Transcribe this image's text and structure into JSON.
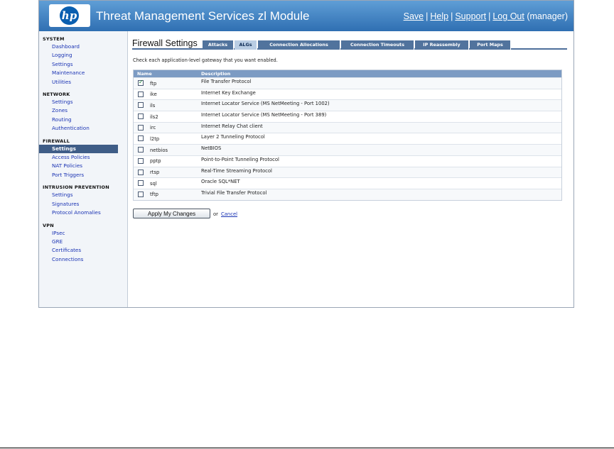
{
  "header": {
    "app_title": "Threat Management Services zl Module",
    "logo_text": "hp",
    "links": {
      "save": "Save",
      "help": "Help",
      "support": "Support",
      "logout": "Log Out",
      "separator": "|",
      "user": "(manager)"
    }
  },
  "sidebar": {
    "system": {
      "heading": "System",
      "items": [
        "Dashboard",
        "Logging",
        "Settings",
        "Maintenance",
        "Utilities"
      ]
    },
    "network": {
      "heading": "Network",
      "items": [
        "Settings",
        "Zones",
        "Routing",
        "Authentication"
      ]
    },
    "firewall": {
      "heading": "Firewall",
      "items": [
        "Settings",
        "Access Policies",
        "NAT Policies",
        "Port Triggers"
      ],
      "active_index": 0
    },
    "ips": {
      "heading": "Intrusion Prevention",
      "items": [
        "Settings",
        "Signatures",
        "Protocol Anomalies"
      ]
    },
    "vpn": {
      "heading": "VPN",
      "items": [
        "IPsec",
        "GRE",
        "Certificates",
        "Connections"
      ]
    }
  },
  "main": {
    "page_title": "Firewall Settings",
    "tabs": [
      "Attacks",
      "ALGs",
      "Connection Allocations",
      "Connection Timeouts",
      "IP Reassembly",
      "Port Maps"
    ],
    "active_tab": "ALGs",
    "instructions": "Check each application-level gateway that you want enabled.",
    "table": {
      "columns": [
        "Name",
        "Description"
      ],
      "rows": [
        {
          "name": "ftp",
          "description": "File Transfer Protocol",
          "checked": true
        },
        {
          "name": "ike",
          "description": "Internet Key Exchange",
          "checked": false
        },
        {
          "name": "ils",
          "description": "Internet Locator Service (MS NetMeeting - Port 1002)",
          "checked": false
        },
        {
          "name": "ils2",
          "description": "Internet Locator Service (MS NetMeeting - Port 389)",
          "checked": false
        },
        {
          "name": "irc",
          "description": "Internet Relay Chat client",
          "checked": false
        },
        {
          "name": "l2tp",
          "description": "Layer 2 Tunneling Protocol",
          "checked": false
        },
        {
          "name": "netbios",
          "description": "NetBIOS",
          "checked": false
        },
        {
          "name": "pptp",
          "description": "Point-to-Point Tunneling Protocol",
          "checked": false
        },
        {
          "name": "rtsp",
          "description": "Real-Time Streaming Protocol",
          "checked": false
        },
        {
          "name": "sql",
          "description": "Oracle SQL*NET",
          "checked": false
        },
        {
          "name": "tftp",
          "description": "Trivial File Transfer Protocol",
          "checked": false
        }
      ]
    },
    "actions": {
      "apply_label": "Apply My Changes",
      "or_text": "or",
      "cancel_label": "Cancel"
    }
  },
  "colors": {
    "header_top": "#5f9ed6",
    "header_bottom": "#2f6fb2",
    "tab": "#51739d",
    "tab_active": "#b9cde3",
    "table_header": "#7c9bc3",
    "nav_active": "#3f5d87",
    "link": "#1a33b3"
  }
}
